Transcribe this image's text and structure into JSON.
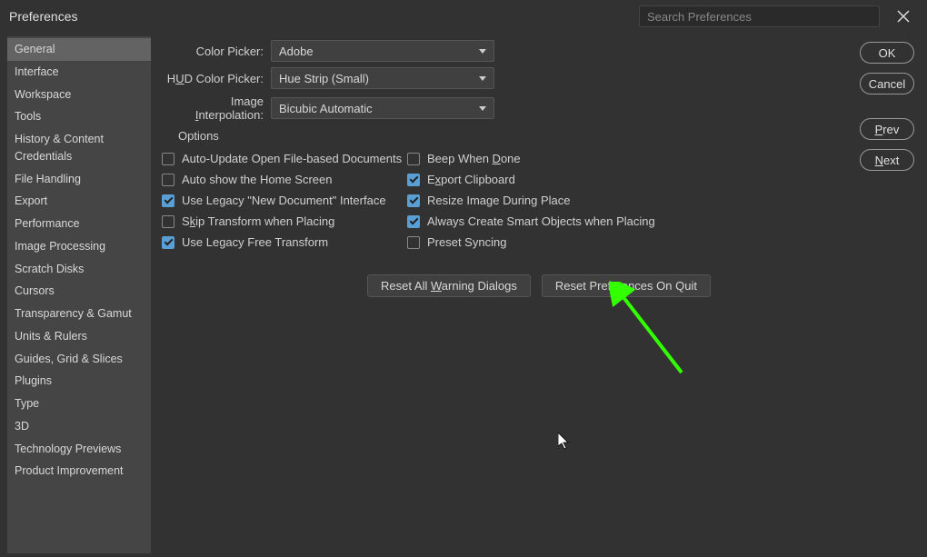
{
  "window": {
    "title": "Preferences",
    "search_placeholder": "Search Preferences"
  },
  "sidebar": {
    "items": [
      {
        "label": "General",
        "selected": true
      },
      {
        "label": "Interface",
        "selected": false
      },
      {
        "label": "Workspace",
        "selected": false
      },
      {
        "label": "Tools",
        "selected": false
      },
      {
        "label": "History & Content Credentials",
        "selected": false
      },
      {
        "label": "File Handling",
        "selected": false
      },
      {
        "label": "Export",
        "selected": false
      },
      {
        "label": "Performance",
        "selected": false
      },
      {
        "label": "Image Processing",
        "selected": false
      },
      {
        "label": "Scratch Disks",
        "selected": false
      },
      {
        "label": "Cursors",
        "selected": false
      },
      {
        "label": "Transparency & Gamut",
        "selected": false
      },
      {
        "label": "Units & Rulers",
        "selected": false
      },
      {
        "label": "Guides, Grid & Slices",
        "selected": false
      },
      {
        "label": "Plugins",
        "selected": false
      },
      {
        "label": "Type",
        "selected": false
      },
      {
        "label": "3D",
        "selected": false
      },
      {
        "label": "Technology Previews",
        "selected": false
      },
      {
        "label": "Product Improvement",
        "selected": false
      }
    ]
  },
  "form": {
    "color_picker": {
      "label": "Color Picker:",
      "value": "Adobe"
    },
    "hud_color_picker": {
      "label_pre": "H",
      "label_u": "U",
      "label_post": "D Color Picker:",
      "value": "Hue Strip (Small)"
    },
    "image_interpolation": {
      "label_pre": "Image ",
      "label_u": "I",
      "label_post": "nterpolation:",
      "value": "Bicubic Automatic"
    }
  },
  "options": {
    "header": "Options",
    "left": [
      {
        "label": "Auto-Update Open File-based Documents",
        "checked": false
      },
      {
        "label": "Auto show the Home Screen",
        "checked": false
      },
      {
        "label": "Use Legacy \"New Document\" Interface",
        "checked": true
      },
      {
        "pre": "S",
        "u": "k",
        "post": "ip Transform when Placing",
        "checked": false
      },
      {
        "label": "Use Legacy Free Transform",
        "checked": true
      }
    ],
    "right": [
      {
        "pre": "Beep When ",
        "u": "D",
        "post": "one",
        "checked": false
      },
      {
        "pre": "E",
        "u": "x",
        "post": "port Clipboard",
        "checked": true
      },
      {
        "label": "Resize Image During Place",
        "checked": true
      },
      {
        "label": "Always Create Smart Objects when Placing",
        "checked": true
      },
      {
        "label": "Preset Syncing",
        "checked": false
      }
    ]
  },
  "actions": {
    "reset_warnings": {
      "pre": "Reset All ",
      "u": "W",
      "post": "arning Dialogs"
    },
    "reset_on_quit": "Reset Preferences On Quit"
  },
  "buttons": {
    "ok": "OK",
    "cancel": "Cancel",
    "prev": {
      "u": "P",
      "post": "rev"
    },
    "next": {
      "u": "N",
      "post": "ext"
    }
  }
}
